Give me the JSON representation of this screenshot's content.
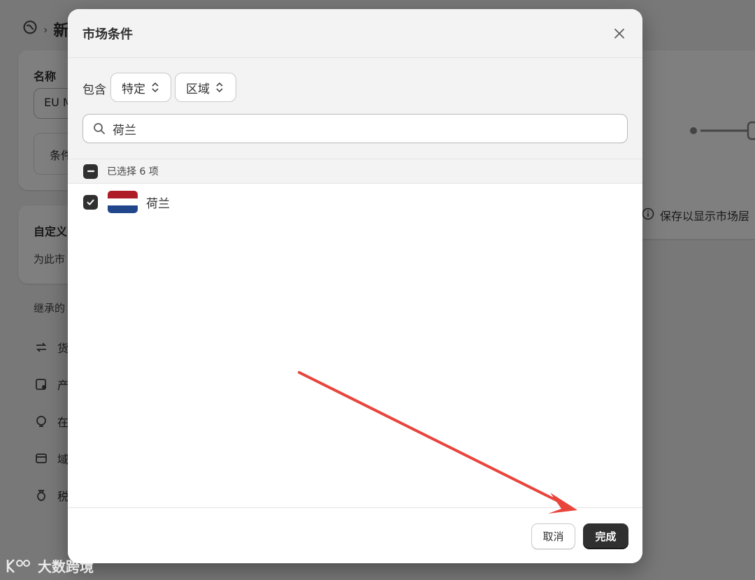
{
  "background": {
    "breadcrumb_current": "新",
    "name_label": "名称",
    "name_value": "EU M",
    "conditions_label": "条件",
    "custom_title": "自定义",
    "custom_subtitle": "为此市",
    "inherit_title": "继承的",
    "side_items": [
      {
        "label": "货",
        "icon": "currency-icon"
      },
      {
        "label": "产",
        "icon": "product-icon"
      },
      {
        "label": "在",
        "icon": "store-icon"
      },
      {
        "label": "域",
        "icon": "domain-icon"
      },
      {
        "label": "税",
        "icon": "tax-icon"
      }
    ],
    "save_hint": "保存以显示市场层"
  },
  "modal": {
    "title": "市场条件",
    "include_label": "包含",
    "select_scope": "特定",
    "select_type": "区域",
    "search_value": "荷兰",
    "search_placeholder": "搜索",
    "selected_text": "已选择 6 项",
    "items": [
      {
        "label": "荷兰",
        "checked": true,
        "flag_colors": [
          "#AE1C28",
          "#FFFFFF",
          "#21468B"
        ]
      }
    ],
    "cancel_label": "取消",
    "done_label": "完成"
  },
  "watermark": "大数跨境",
  "colors": {
    "primary_button": "#303030",
    "annotation_arrow": "#E8453C"
  }
}
